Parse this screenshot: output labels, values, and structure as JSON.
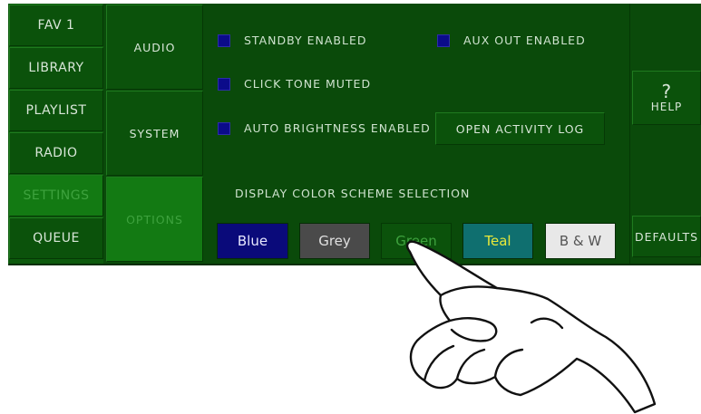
{
  "nav": {
    "items": [
      {
        "label": "FAV 1"
      },
      {
        "label": "LIBRARY"
      },
      {
        "label": "PLAYLIST"
      },
      {
        "label": "RADIO"
      },
      {
        "label": "SETTINGS"
      },
      {
        "label": "QUEUE"
      }
    ]
  },
  "subnav": {
    "items": [
      {
        "label": "AUDIO"
      },
      {
        "label": "SYSTEM"
      },
      {
        "label": "OPTIONS"
      }
    ]
  },
  "options": {
    "standby": "STANDBY ENABLED",
    "aux_out": "AUX OUT ENABLED",
    "click_tone": "CLICK TONE MUTED",
    "auto_brightness": "AUTO BRIGHTNESS ENABLED",
    "activity_log_button": "OPEN ACTIVITY LOG",
    "color_scheme_heading": "DISPLAY COLOR SCHEME SELECTION"
  },
  "schemes": [
    {
      "label": "Blue",
      "bg": "#0a0a7a",
      "fg": "#e8e8ff"
    },
    {
      "label": "Grey",
      "bg": "#4a4a4a",
      "fg": "#e0e0e0"
    },
    {
      "label": "Green",
      "bg": "#0b520b",
      "fg": "#3ea23e"
    },
    {
      "label": "Teal",
      "bg": "#0f6f6f",
      "fg": "#e8e83a"
    },
    {
      "label": "B & W",
      "bg": "#e8e8e8",
      "fg": "#555555"
    }
  ],
  "right": {
    "help_symbol": "?",
    "help_label": "HELP",
    "defaults_label": "DEFAULTS"
  }
}
